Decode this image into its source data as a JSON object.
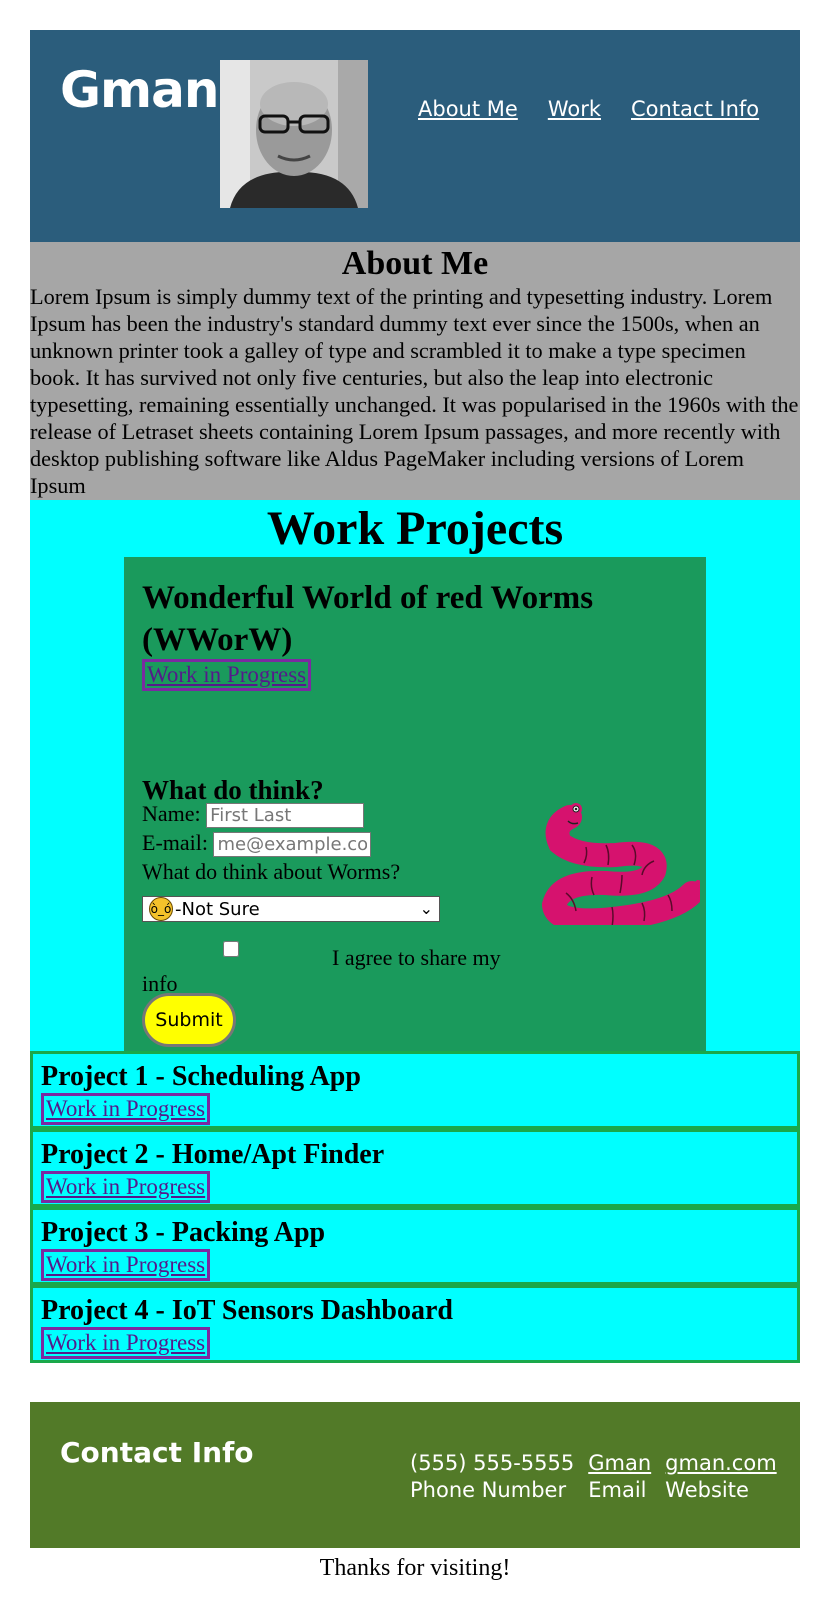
{
  "header": {
    "brand": "Gman",
    "nav": [
      "About Me",
      "Work",
      "Contact Info"
    ]
  },
  "about": {
    "title": "About Me",
    "body": "Lorem Ipsum is simply dummy text of the printing and typesetting industry. Lorem Ipsum has been the industry's standard dummy text ever since the 1500s, when an unknown printer took a galley of type and scrambled it to make a type specimen book. It has survived not only five centuries, but also the leap into electronic typesetting, remaining essentially unchanged. It was popularised in the 1960s with the release of Letraset sheets containing Lorem Ipsum passages, and more recently with desktop publishing software like Aldus PageMaker including versions of Lorem Ipsum"
  },
  "work": {
    "title": "Work Projects",
    "feature": {
      "title": "Wonderful World of red Worms (WWorW)",
      "link": "Work in Progress",
      "form_title": "What do think?",
      "name_label": "Name:",
      "name_placeholder": "First Last",
      "email_label": "E-mail:",
      "email_placeholder": "me@example.com",
      "worms_label": "What do think about Worms?",
      "worms_selected": "-Not Sure",
      "agree_label": "I agree to share my",
      "agree_label_2": "info",
      "submit": "Submit"
    },
    "projects": [
      {
        "title": "Project 1 - Scheduling App",
        "link": "Work in Progress"
      },
      {
        "title": "Project 2 - Home/Apt Finder",
        "link": "Work in Progress"
      },
      {
        "title": "Project 3 - Packing App",
        "link": "Work in Progress"
      },
      {
        "title": "Project 4 - IoT Sensors Dashboard",
        "link": "Work in Progress"
      }
    ]
  },
  "contact": {
    "title": "Contact Info",
    "phone": "(555) 555-5555",
    "phone_label": "Phone Number",
    "email": "Gman",
    "email_label": "Email",
    "website": "gman.com",
    "website_label": "Website"
  },
  "footer": "Thanks for visiting!",
  "colors": {
    "header_bg": "#2b5d7c",
    "about_bg": "#a6a6a6",
    "work_bg": "#00ffff",
    "feature_bg": "#1a9a5c",
    "contact_bg": "#527a28",
    "submit_bg": "#ffff00",
    "worm": "#d6126e"
  }
}
